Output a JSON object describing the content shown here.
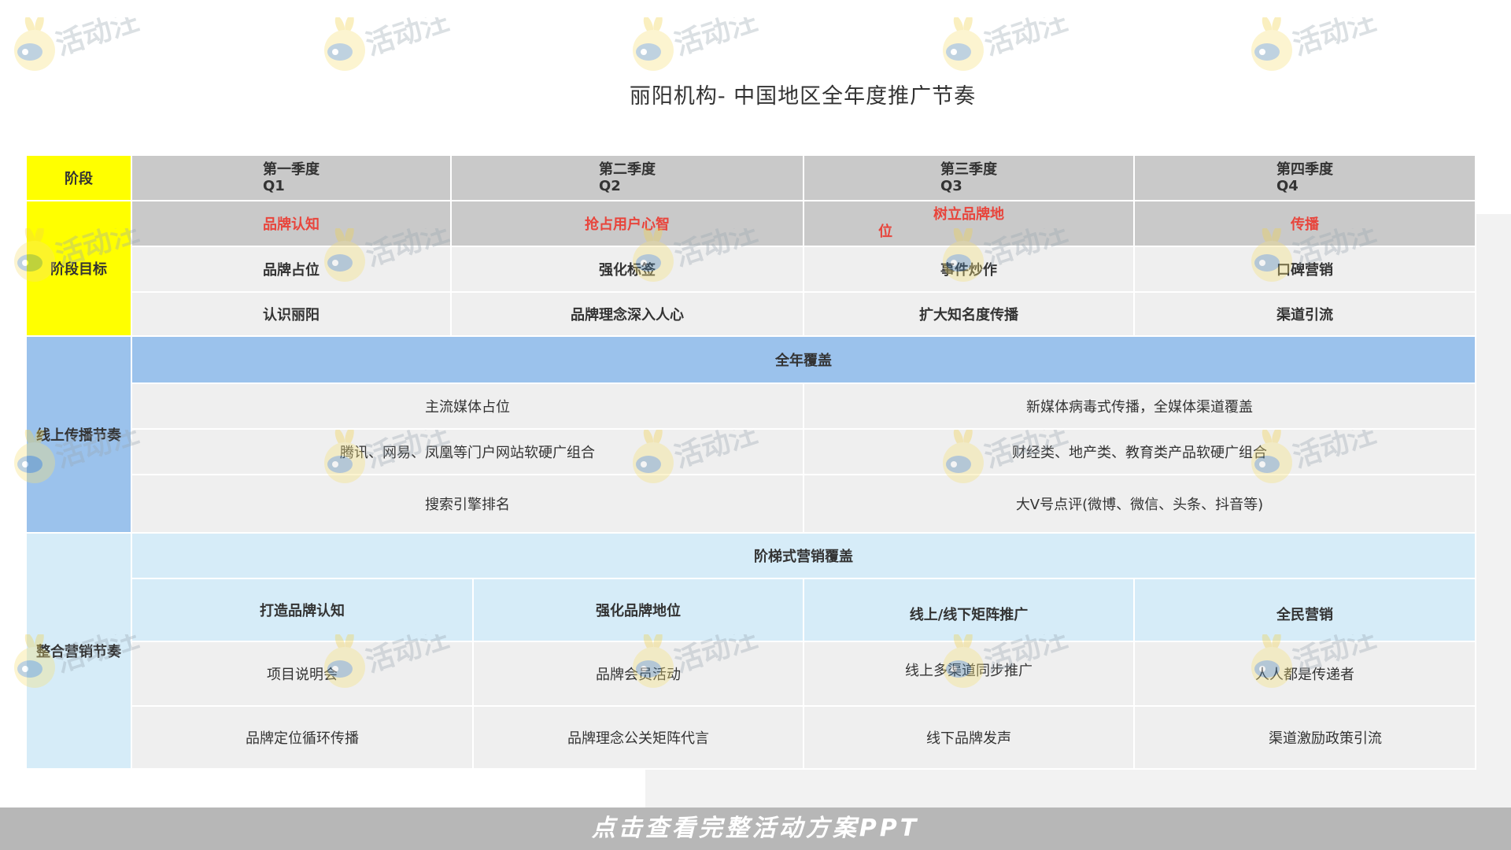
{
  "page": {
    "title": "丽阳机构- 中国地区全年度推广节奏",
    "cta": "点击查看完整活动方案PPT",
    "watermark_text": "活动汪"
  },
  "table": {
    "stage_label": "阶段",
    "quarters": [
      {
        "name": "第一季度",
        "code": "Q1"
      },
      {
        "name": "第二季度",
        "code": "Q2"
      },
      {
        "name": "第三季度",
        "code": "Q3"
      },
      {
        "name": "第四季度",
        "code": "Q4"
      }
    ],
    "goal_label": "阶段目标",
    "goal_titles": [
      "品牌认知",
      "抢占用户心智",
      "树立品牌地",
      "传播"
    ],
    "goal_title_3_wrap": "位",
    "goal_row1": [
      "品牌占位",
      "强化标签",
      "事件炒作",
      "口碑营销"
    ],
    "goal_row2": [
      "认识丽阳",
      "品牌理念深入人心",
      "扩大知名度传播",
      "渠道引流"
    ],
    "online_label": "线上传播节奏",
    "online_band": "全年覆盖",
    "online_rows": [
      [
        "主流媒体占位",
        "新媒体病毒式传播，全媒体渠道覆盖"
      ],
      [
        "腾讯、网易、凤凰等门户网站软硬广组合",
        "财经类、地产类、教育类产品软硬广组合"
      ],
      [
        "搜索引擎排名",
        "大V号点评(微博、微信、头条、抖音等)"
      ]
    ],
    "integ_label": "整合营销节奏",
    "integ_band": "阶梯式营销覆盖",
    "integ_cols": [
      "打造品牌认知",
      "强化品牌地位",
      "线上/线下矩阵推广",
      "全民营销"
    ],
    "integ_row1": [
      "项目说明会",
      "品牌会员活动",
      "线上多渠道同步推广",
      "人人都是传递者"
    ],
    "integ_row2": [
      "品牌定位循环传播",
      "品牌理念公关矩阵代言",
      "线下品牌发声",
      "渠道激励政策引流"
    ]
  },
  "colors": {
    "stage_yellow": "#ffff00",
    "header_grey": "#c9c9c9",
    "cell_grey": "#efefef",
    "online_blue": "#9bc2ec",
    "integ_light_blue": "#d6ecf8",
    "goal_red": "#e8453c",
    "cta_grey": "#b7b7b7"
  }
}
